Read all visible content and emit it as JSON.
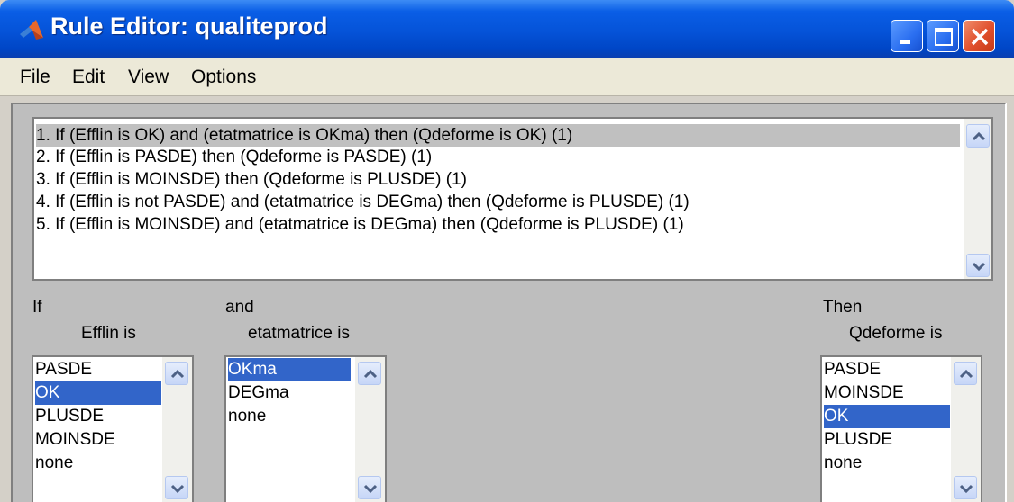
{
  "window": {
    "title": "Rule Editor: qualiteprod"
  },
  "menu": [
    "File",
    "Edit",
    "View",
    "Options"
  ],
  "rules": {
    "items": [
      "1. If (Efflin is OK) and (etatmatrice is OKma) then (Qdeforme is OK) (1)",
      "2. If (Efflin is PASDE) then (Qdeforme is PASDE) (1)",
      "3. If (Efflin is MOINSDE) then (Qdeforme is PLUSDE) (1)",
      "4. If (Efflin is not PASDE) and (etatmatrice is DEGma) then (Qdeforme is PLUSDE) (1)",
      "5. If (Efflin is MOINSDE) and (etatmatrice is DEGma) then (Qdeforme is PLUSDE) (1)"
    ],
    "selected_index": 0
  },
  "if_section": {
    "connector": "If",
    "variable": "Efflin is",
    "options": [
      "PASDE",
      "OK",
      "PLUSDE",
      "MOINSDE",
      "none"
    ],
    "selected": "OK"
  },
  "and_section": {
    "connector": "and",
    "variable": "etatmatrice is",
    "options": [
      "OKma",
      "DEGma",
      "none"
    ],
    "selected": "OKma"
  },
  "then_section": {
    "connector": "Then",
    "variable": "Qdeforme is",
    "options": [
      "PASDE",
      "MOINSDE",
      "OK",
      "PLUSDE",
      "none"
    ],
    "selected": "OK"
  },
  "icons": {
    "app": "matlab-logo-icon",
    "minimize": "minimize-icon",
    "maximize": "maximize-icon",
    "close": "close-icon",
    "scroll_up": "chevron-up-icon",
    "scroll_down": "chevron-down-icon"
  },
  "colors": {
    "title_bar": "#0553d8",
    "selection": "#3265c9",
    "rule_selection": "#c0c0c0",
    "panel": "#bebebe"
  }
}
